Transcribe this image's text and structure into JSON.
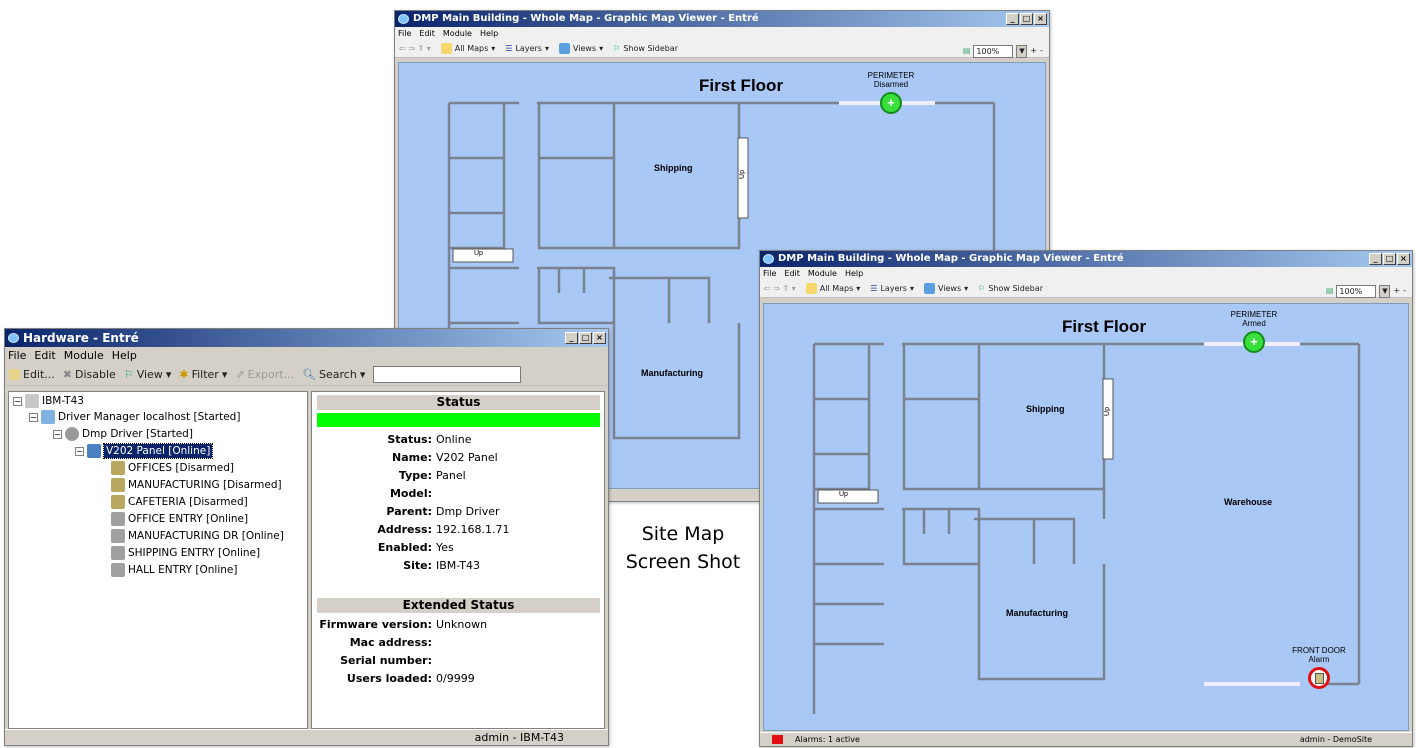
{
  "top_map": {
    "title": "DMP Main Building - Whole Map - Graphic Map Viewer - Entré",
    "menu": [
      "File",
      "Edit",
      "Module",
      "Help"
    ],
    "toolbar": {
      "all_maps": "All Maps",
      "layers": "Layers",
      "views": "Views",
      "show_sidebar": "Show Sidebar",
      "zoom": "100%"
    },
    "floor_title": "First Floor",
    "perimeter": {
      "label": "PERIMETER",
      "state": "Disarmed"
    },
    "rooms": {
      "shipping": "Shipping",
      "manufacturing": "Manufacturing",
      "up_a": "Up",
      "up_b": "Up"
    }
  },
  "right_map": {
    "title": "DMP Main Building - Whole Map - Graphic Map Viewer - Entré",
    "menu": [
      "File",
      "Edit",
      "Module",
      "Help"
    ],
    "toolbar": {
      "all_maps": "All Maps",
      "layers": "Layers",
      "views": "Views",
      "show_sidebar": "Show Sidebar",
      "zoom": "100%"
    },
    "floor_title": "First Floor",
    "perimeter": {
      "label": "PERIMETER",
      "state": "Armed"
    },
    "front_door": {
      "label": "FRONT DOOR",
      "state": "Alarm"
    },
    "rooms": {
      "shipping": "Shipping",
      "manufacturing": "Manufacturing",
      "warehouse": "Warehouse",
      "up_a": "Up",
      "up_b": "Up"
    },
    "status": {
      "alarms": "Alarms: 1 active",
      "user": "admin - DemoSite"
    }
  },
  "hardware": {
    "title": "Hardware - Entré",
    "menu": [
      "File",
      "Edit",
      "Module",
      "Help"
    ],
    "toolbar": {
      "edit": "Edit...",
      "disable": "Disable",
      "view": "View",
      "filter": "Filter",
      "export": "Export...",
      "search": "Search"
    },
    "tree": {
      "root": "IBM-T43",
      "driver_manager": "Driver Manager localhost [Started]",
      "dmp_driver": "Dmp Driver [Started]",
      "panel": "V202 Panel [Online]",
      "children": [
        "OFFICES [Disarmed]",
        "MANUFACTURING [Disarmed]",
        "CAFETERIA [Disarmed]",
        "OFFICE ENTRY [Online]",
        "MANUFACTURING DR [Online]",
        "SHIPPING ENTRY [Online]",
        "HALL ENTRY [Online]"
      ]
    },
    "status_header": "Status",
    "status_color": "#00ff00",
    "props": [
      {
        "k": "Status:",
        "v": "Online"
      },
      {
        "k": "Name:",
        "v": "V202 Panel"
      },
      {
        "k": "Type:",
        "v": "Panel"
      },
      {
        "k": "Model:",
        "v": ""
      },
      {
        "k": "Parent:",
        "v": "Dmp Driver"
      },
      {
        "k": "Address:",
        "v": "192.168.1.71"
      },
      {
        "k": "Enabled:",
        "v": "Yes"
      },
      {
        "k": "Site:",
        "v": "IBM-T43"
      }
    ],
    "extended_header": "Extended Status",
    "ext_props": [
      {
        "k": "Firmware version:",
        "v": "Unknown"
      },
      {
        "k": "Mac address:",
        "v": ""
      },
      {
        "k": "Serial number:",
        "v": ""
      },
      {
        "k": "Users loaded:",
        "v": "0/9999"
      }
    ],
    "status_user": "admin - IBM-T43"
  },
  "caption": {
    "line1": "Site Map",
    "line2": "Screen Shot"
  }
}
